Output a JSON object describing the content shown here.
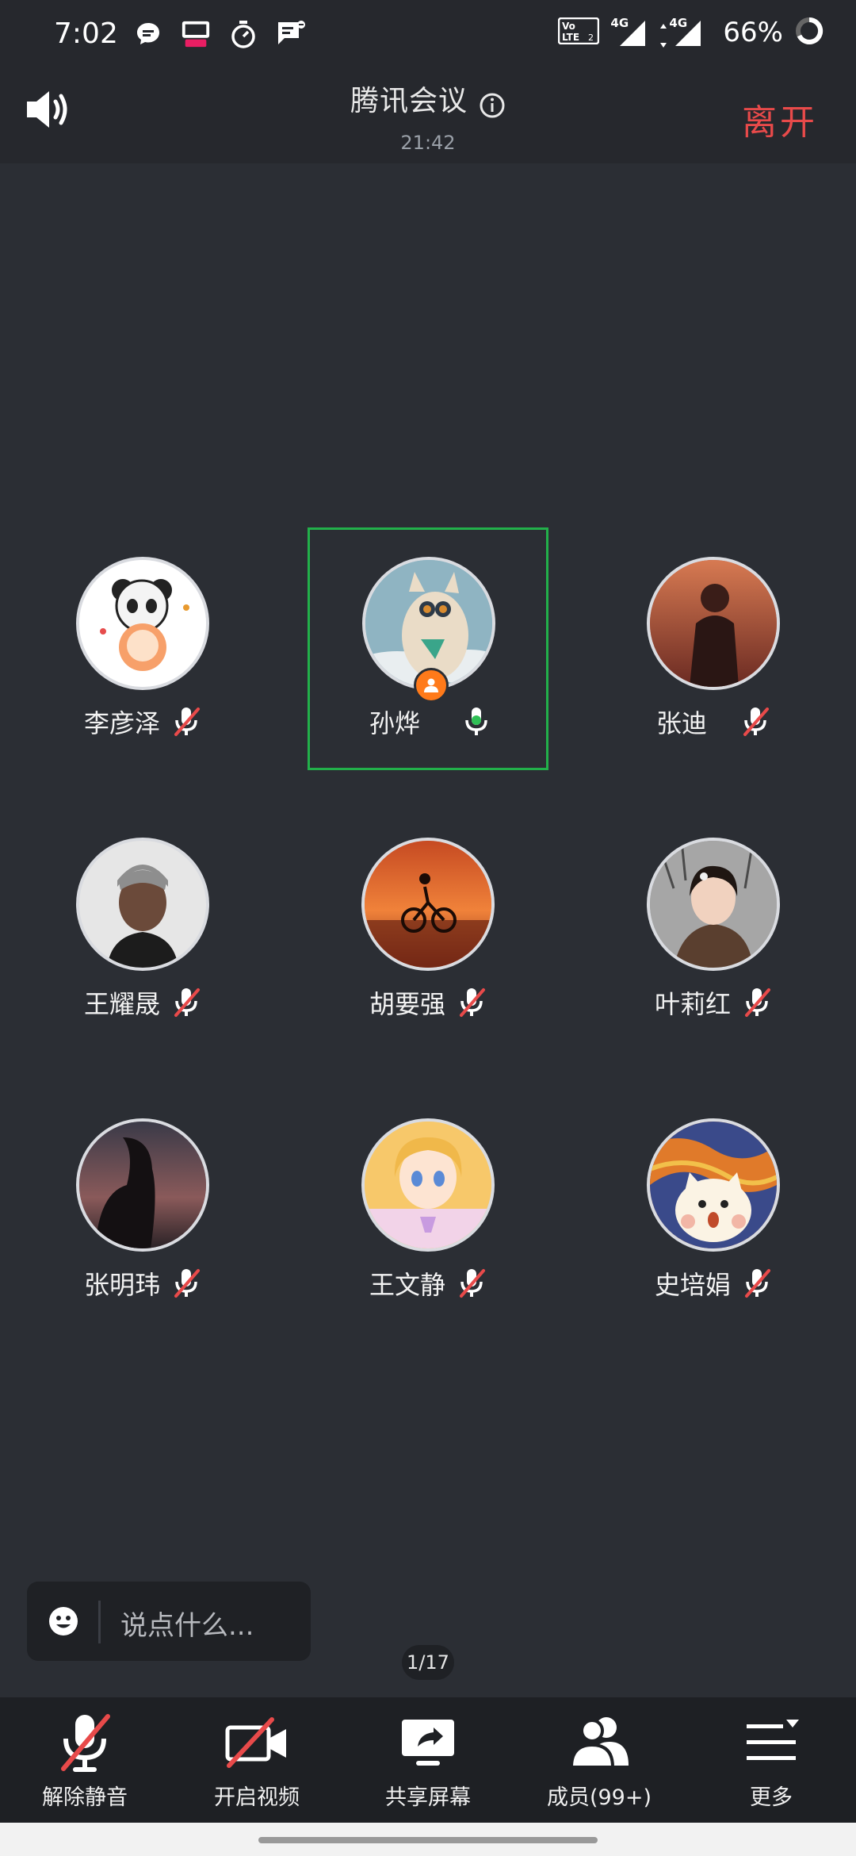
{
  "status_bar": {
    "time": "7:02",
    "battery": "66%",
    "icons": [
      "chat-bubble-icon",
      "app-badge-icon",
      "timer-icon",
      "message-icon",
      "volte-icon",
      "signal-4g-icon",
      "signal-4g-icon",
      "battery-ring-icon"
    ],
    "net_label_1": "4G",
    "net_label_2": "4G",
    "volte_label": "VoLTE"
  },
  "header": {
    "title": "腾讯会议",
    "duration": "21:42",
    "leave_label": "离开",
    "leave_color": "#e84a4a"
  },
  "participants": [
    {
      "name": "李彦泽",
      "mic": "muted",
      "avatar": "panda-sticker-avatar"
    },
    {
      "name": "孙烨",
      "mic": "active",
      "avatar": "cat-binoculars-avatar",
      "host": true,
      "speaking_highlight": true
    },
    {
      "name": "张迪",
      "mic": "muted",
      "avatar": "sunset-portrait-avatar"
    },
    {
      "name": "王耀晟",
      "mic": "muted",
      "avatar": "man-beanie-avatar"
    },
    {
      "name": "胡要强",
      "mic": "muted",
      "avatar": "cyclist-sunset-avatar"
    },
    {
      "name": "叶莉红",
      "mic": "muted",
      "avatar": "girl-tree-avatar"
    },
    {
      "name": "张明玮",
      "mic": "muted",
      "avatar": "silhouette-dusk-avatar"
    },
    {
      "name": "王文静",
      "mic": "muted",
      "avatar": "anime-girl-avatar"
    },
    {
      "name": "史培娟",
      "mic": "muted",
      "avatar": "scream-cat-avatar"
    }
  ],
  "chat": {
    "placeholder": "说点什么..."
  },
  "pager": {
    "label": "1/17"
  },
  "toolbar": {
    "items": [
      {
        "label": "解除静音",
        "icon": "mic-muted-icon"
      },
      {
        "label": "开启视频",
        "icon": "video-off-icon"
      },
      {
        "label": "共享屏幕",
        "icon": "share-screen-icon"
      },
      {
        "label": "成员(99+)",
        "icon": "members-icon"
      },
      {
        "label": "更多",
        "icon": "more-menu-icon"
      }
    ]
  },
  "colors": {
    "background": "#2b2e34",
    "toolbar": "#1e2024",
    "speaking_border": "#22b04a",
    "mute_slash": "#e84a4a",
    "mic_active": "#2fbf55",
    "host_badge": "#ff7a1a"
  }
}
